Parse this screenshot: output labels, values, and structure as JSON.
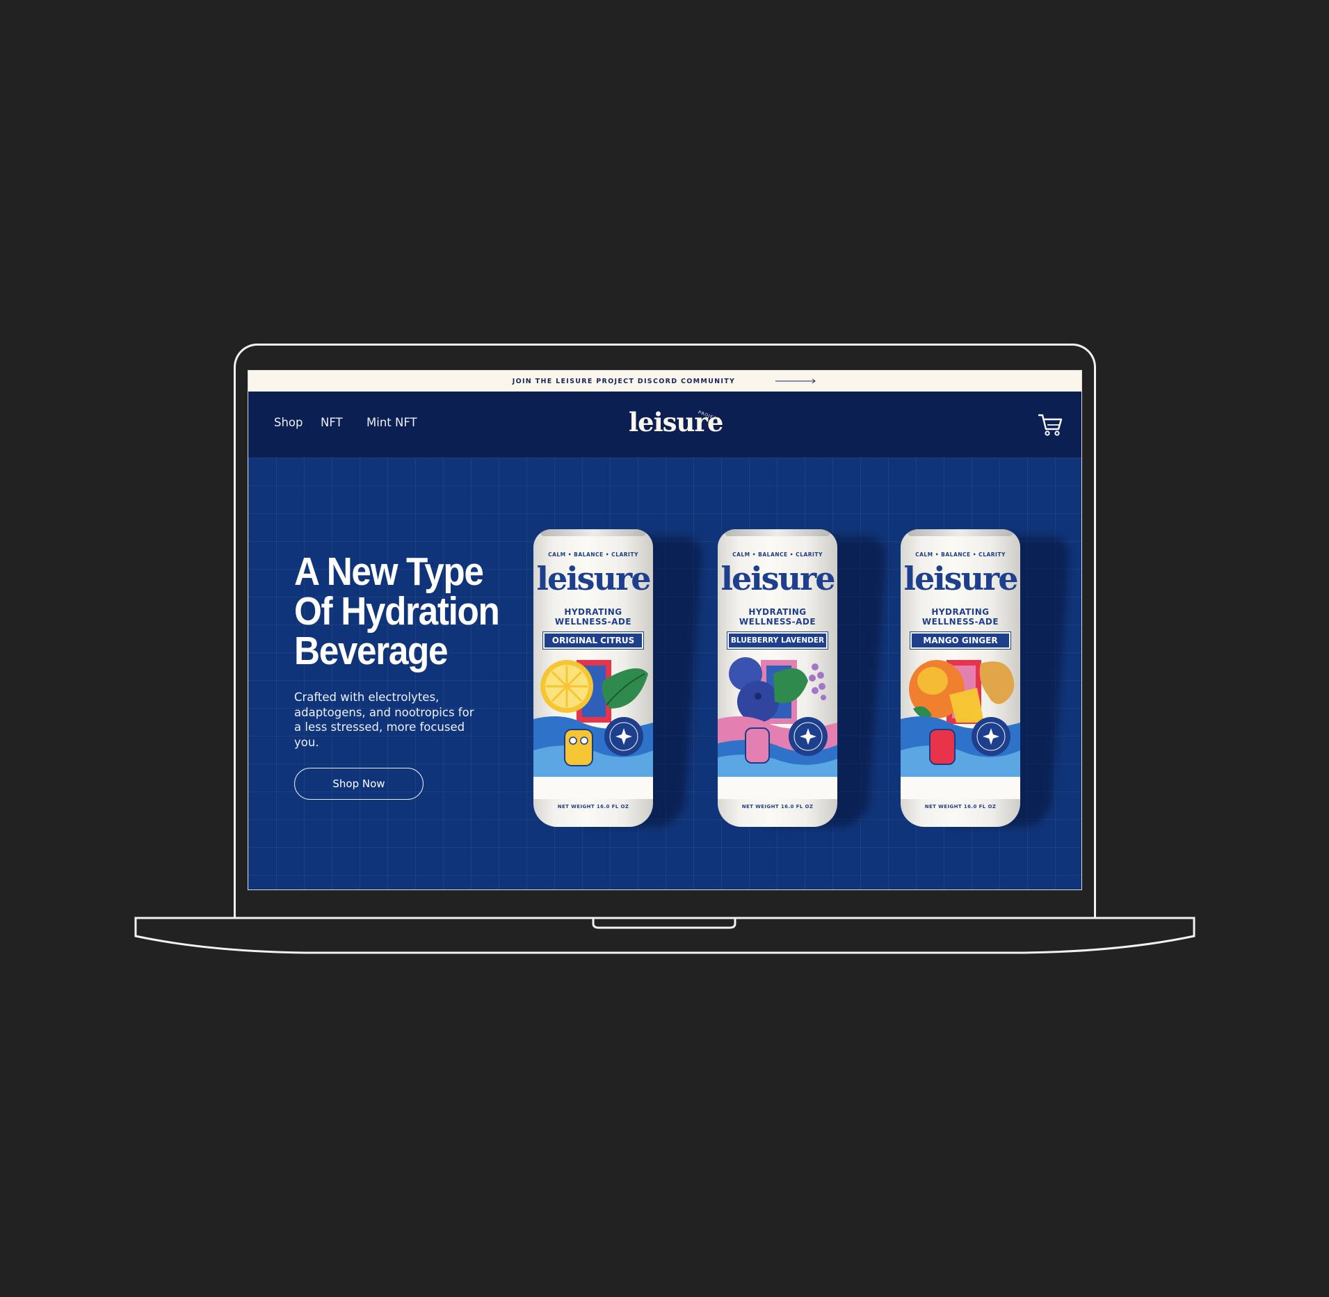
{
  "announcement": {
    "text": "JOIN THE LEISURE PROJECT DISCORD COMMUNITY"
  },
  "nav": {
    "links": [
      "Shop",
      "NFT",
      "Mint NFT"
    ],
    "brand": "leisure",
    "brand_tag": "PROJECT"
  },
  "hero": {
    "title_lines": [
      "A New Type",
      "Of Hydration",
      "Beverage"
    ],
    "subtitle": "Crafted with electrolytes, adaptogens, and nootropics for a less stressed, more focused you.",
    "cta_label": "Shop Now"
  },
  "cans": [
    {
      "tagline": "CALM • BALANCE • CLARITY",
      "brand": "leisure",
      "sub1": "HYDRATING",
      "sub2": "WELLNESS-ADE",
      "flavor": "ORIGINAL CITRUS",
      "weight": "NET WEIGHT 16.0 FL OZ"
    },
    {
      "tagline": "CALM • BALANCE • CLARITY",
      "brand": "leisure",
      "sub1": "HYDRATING",
      "sub2": "WELLNESS-ADE",
      "flavor": "BLUEBERRY LAVENDER",
      "weight": "NET WEIGHT 16.0 FL OZ"
    },
    {
      "tagline": "CALM • BALANCE • CLARITY",
      "brand": "leisure",
      "sub1": "HYDRATING",
      "sub2": "WELLNESS-ADE",
      "flavor": "MANGO GINGER",
      "weight": "NET WEIGHT 16.0 FL OZ"
    }
  ],
  "colors": {
    "page_bg": "#222222",
    "nav_bg": "#0c1f52",
    "hero_bg": "#103479",
    "announcement_bg": "#fbf6ec",
    "can_accent": "#1e3f8e"
  },
  "icons": [
    "arrow-right-icon",
    "cart-icon"
  ]
}
